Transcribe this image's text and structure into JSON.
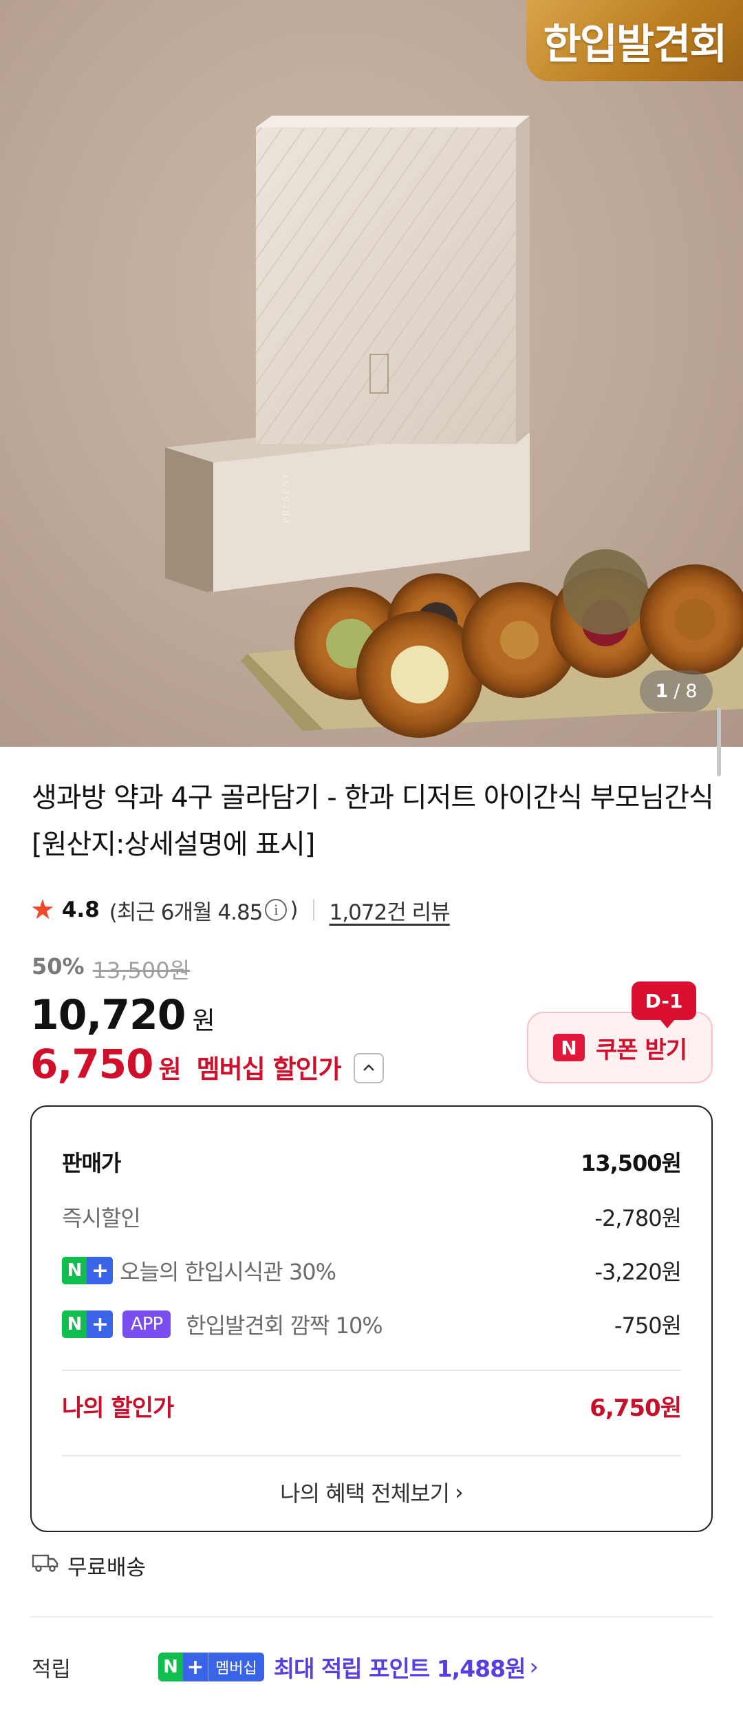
{
  "hero": {
    "badge": "한입발견회",
    "image_counter_current": "1",
    "image_counter_total": "8",
    "box_brand": "생과방",
    "box_tagline": "PRESENT TIMELESS DELIGHTS"
  },
  "product": {
    "title": "생과방 약과 4구 골라담기 - 한과 디저트 아이간식 부모님간식 [원산지:상세설명에 표시]",
    "rating": "4.8",
    "recent_rating": "(최근 6개월 4.85",
    "recent_close": ")",
    "review_count": "1,072건 리뷰"
  },
  "price": {
    "discount_pct": "50%",
    "original": "13,500원",
    "sale": "10,720",
    "won": "원",
    "member_price": "6,750",
    "member_won": "원",
    "member_label": "멤버십 할인가"
  },
  "coupon": {
    "dday": "D-1",
    "n_mark": "N",
    "label": "쿠폰 받기"
  },
  "breakdown": {
    "rows": [
      {
        "label": "판매가",
        "value": "13,500원"
      },
      {
        "label": "즉시할인",
        "value": "-2,780원"
      },
      {
        "label": "오늘의 한입시식관 30%",
        "value": "-3,220원"
      },
      {
        "app_tag": "APP",
        "label": "한입발견회 깜짝 10%",
        "value": "-750원"
      }
    ],
    "np_n": "N",
    "np_plus": "+",
    "my_price_label": "나의 할인가",
    "my_price_value": "6,750원",
    "see_all": "나의 혜택 전체보기",
    "see_all_chev": "›"
  },
  "shipping": {
    "label": "무료배송"
  },
  "points": {
    "label": "적립",
    "n": "N",
    "plus": "+",
    "membership": "멤버십",
    "text": "최대 적립 포인트 1,488원",
    "chev": "›"
  }
}
